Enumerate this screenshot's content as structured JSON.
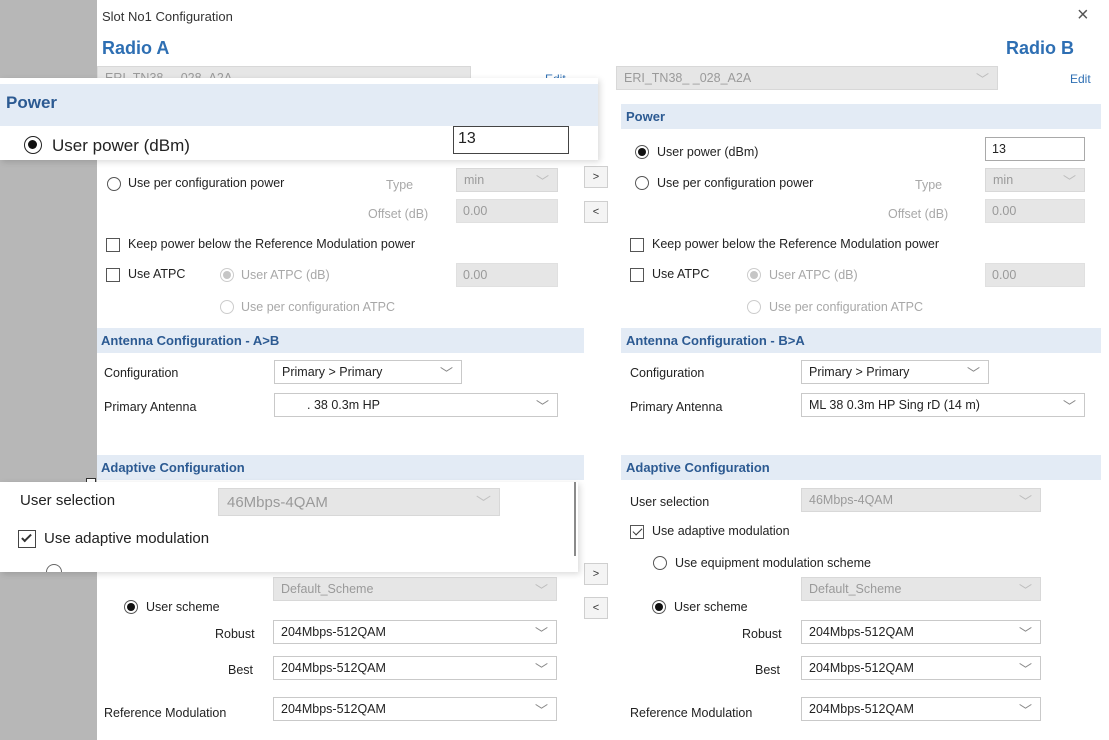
{
  "window": {
    "title": "Slot No1 Configuration",
    "close_glyph": "×"
  },
  "radio_a": {
    "title": "Radio A",
    "device": "ERI_TN38_ _028_A2A",
    "edit": "Edit",
    "power": {
      "section": "Power",
      "user_power_label": "User power (dBm)",
      "user_power_value": "13",
      "per_config_label": "Use per configuration power",
      "type_label": "Type",
      "type_value": "min",
      "offset_label": "Offset (dB)",
      "offset_value": "0.00",
      "keep_below_label": "Keep power below the Reference Modulation power",
      "use_atpc_label": "Use ATPC",
      "user_atpc_label": "User ATPC (dB)",
      "user_atpc_value": "0.00",
      "per_config_atpc_label": "Use per configuration ATPC"
    },
    "antenna": {
      "section": "Antenna Configuration - A>B",
      "config_label": "Configuration",
      "config_value": "Primary > Primary",
      "primary_label": "Primary Antenna",
      "primary_value": ". 38 0.3m HP"
    },
    "adaptive": {
      "section": "Adaptive Configuration",
      "user_selection_label": "User selection",
      "user_selection_value": "46Mbps-4QAM",
      "use_adaptive_label": "Use adaptive modulation",
      "scheme_value": "Default_Scheme",
      "user_scheme_label": "User scheme",
      "robust_label": "Robust",
      "robust_value": "204Mbps-512QAM",
      "best_label": "Best",
      "best_value": "204Mbps-512QAM",
      "refmod_label": "Reference Modulation",
      "refmod_value": "204Mbps-512QAM"
    }
  },
  "radio_b": {
    "title": "Radio B",
    "device": "ERI_TN38_ _028_A2A",
    "edit": "Edit",
    "power": {
      "section": "Power",
      "user_power_label": "User power (dBm)",
      "user_power_value": "13",
      "per_config_label": "Use per configuration power",
      "type_label": "Type",
      "type_value": "min",
      "offset_label": "Offset (dB)",
      "offset_value": "0.00",
      "keep_below_label": "Keep power below the Reference Modulation power",
      "use_atpc_label": "Use ATPC",
      "user_atpc_label": "User ATPC (dB)",
      "user_atpc_value": "0.00",
      "per_config_atpc_label": "Use per configuration ATPC"
    },
    "antenna": {
      "section": "Antenna Configuration - B>A",
      "config_label": "Configuration",
      "config_value": "Primary > Primary",
      "primary_label": "Primary Antenna",
      "primary_value": "ML 38 0.3m HP Sing rD (14 m)"
    },
    "adaptive": {
      "section": "Adaptive Configuration",
      "user_selection_label": "User selection",
      "user_selection_value": "46Mbps-4QAM",
      "use_adaptive_label": "Use adaptive modulation",
      "equipment_scheme_label": "Use equipment modulation scheme",
      "scheme_value": "Default_Scheme",
      "user_scheme_label": "User scheme",
      "robust_label": "Robust",
      "robust_value": "204Mbps-512QAM",
      "best_label": "Best",
      "best_value": "204Mbps-512QAM",
      "refmod_label": "Reference Modulation",
      "refmod_value": "204Mbps-512QAM"
    }
  },
  "copy_buttons": {
    "right": ">",
    "left": "<"
  },
  "icons": {
    "dropdown": "chevron-down-icon",
    "close": "close-icon"
  }
}
